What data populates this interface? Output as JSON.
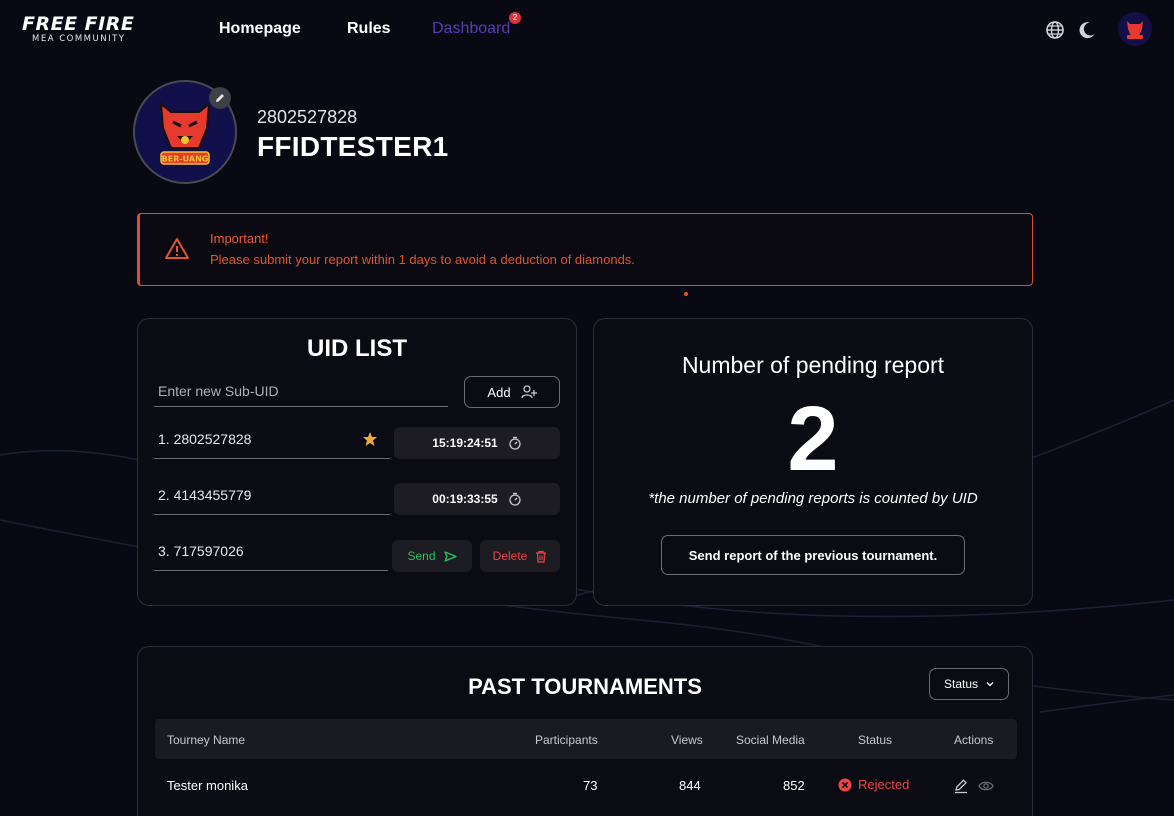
{
  "brand": {
    "logo_main": "FREE FIRE",
    "logo_sub": "MEA COMMUNITY"
  },
  "nav": {
    "items": [
      {
        "label": "Homepage"
      },
      {
        "label": "Rules"
      },
      {
        "label": "Dashboard"
      }
    ],
    "dashboard_badge": "2",
    "icons": [
      "globe-icon",
      "moon-icon"
    ]
  },
  "profile": {
    "uid": "2802527828",
    "name": "FFIDTESTER1",
    "avatar_text": "BER-UANG"
  },
  "alert": {
    "title": "Important!",
    "message": "Please submit your report within 1 days to avoid a deduction of diamonds.",
    "color": "#e0542f"
  },
  "uid_list": {
    "title": "UID LIST",
    "input_placeholder": "Enter new Sub-UID",
    "add_label": "Add",
    "rows": [
      {
        "text": "1. 2802527828",
        "timer": "15:19:24:51",
        "starred": true
      },
      {
        "text": "2. 4143455779",
        "timer": "00:19:33:55"
      },
      {
        "text": "3. 717597026",
        "send_label": "Send",
        "delete_label": "Delete"
      }
    ]
  },
  "pending": {
    "title": "Number of pending report",
    "count": "2",
    "note": "*the number of pending reports is counted by UID",
    "button_label": "Send report of the previous tournament."
  },
  "past": {
    "title": "PAST TOURNAMENTS",
    "filter_label": "Status",
    "columns": [
      "Tourney Name",
      "Participants",
      "Views",
      "Social Media",
      "Status",
      "Actions"
    ],
    "rows": [
      {
        "name": "Tester monika",
        "participants": "73",
        "views": "844",
        "social": "852",
        "status": "Rejected"
      }
    ]
  },
  "colors": {
    "accent_purple": "#5b3bb5",
    "danger": "#ef4444",
    "success": "#22c55e",
    "star": "#f2a93b"
  }
}
